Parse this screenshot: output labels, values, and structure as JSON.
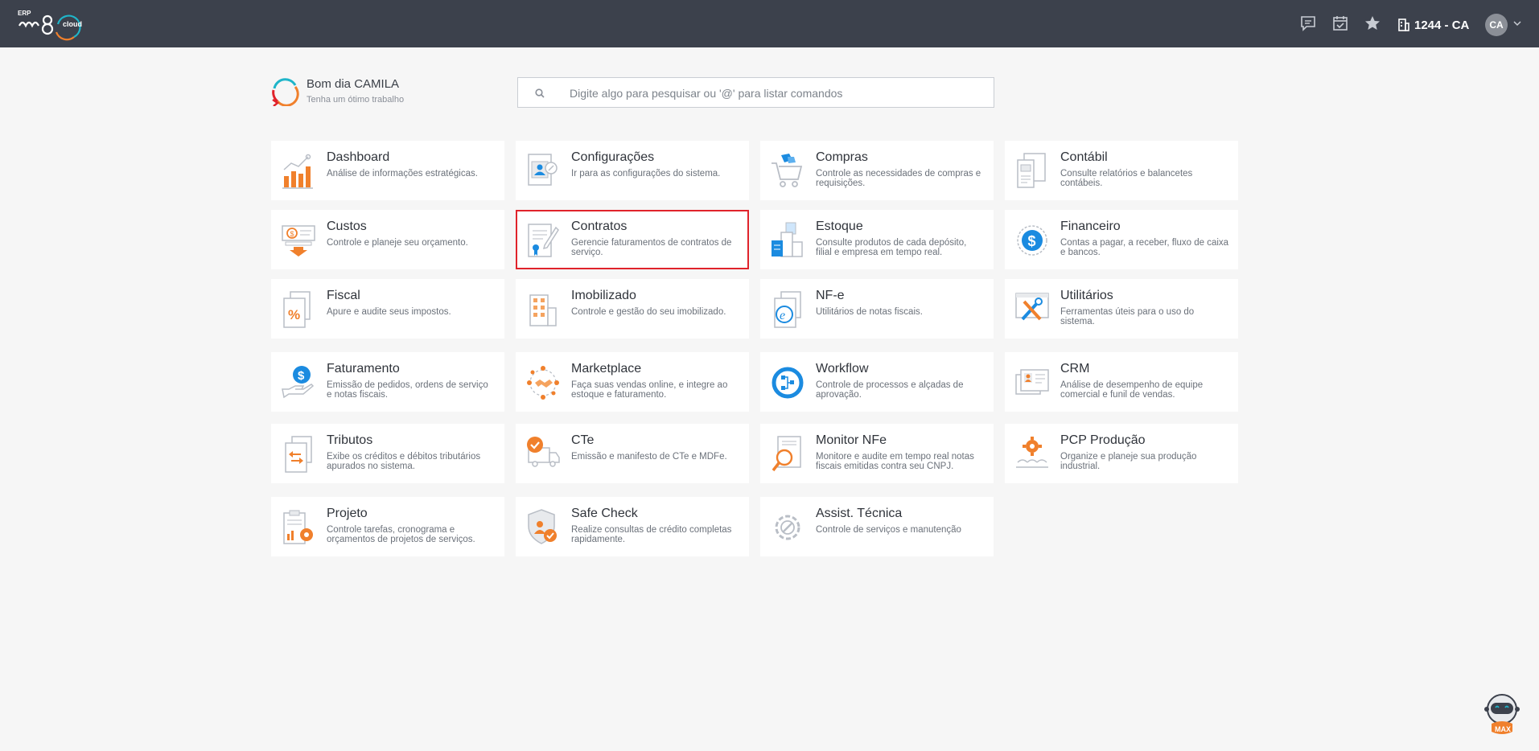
{
  "header": {
    "logo_erp": "ERP",
    "logo_cloud": "cloud",
    "company": "1244 - CA",
    "avatar_initials": "CA"
  },
  "greeting": {
    "title": "Bom dia CAMILA",
    "subtitle": "Tenha um ótimo trabalho"
  },
  "search": {
    "placeholder": "Digite algo para pesquisar ou '@' para listar comandos"
  },
  "modules": [
    {
      "title": "Dashboard",
      "desc": "Análise de informações estratégicas.",
      "icon": "bar-chart-icon"
    },
    {
      "title": "Configurações",
      "desc": "Ir para as configurações do sistema.",
      "icon": "settings-profile-icon"
    },
    {
      "title": "Compras",
      "desc": "Controle as necessidades de compras e requisições.",
      "icon": "shopping-cart-icon"
    },
    {
      "title": "Contábil",
      "desc": "Consulte relatórios e balancetes contábeis.",
      "icon": "accounting-report-icon"
    },
    {
      "title": "Custos",
      "desc": "Controle e planeje seu orçamento.",
      "icon": "costs-icon"
    },
    {
      "title": "Contratos",
      "desc": "Gerencie faturamentos de contratos de serviço.",
      "icon": "contract-icon",
      "selected": true
    },
    {
      "title": "Estoque",
      "desc": "Consulte produtos de cada depósito, filial e empresa em tempo real.",
      "icon": "inventory-icon"
    },
    {
      "title": "Financeiro",
      "desc": "Contas a pagar, a receber, fluxo de caixa e bancos.",
      "icon": "dollar-coin-icon"
    },
    {
      "title": "Fiscal",
      "desc": "Apure e audite seus impostos.",
      "icon": "tax-percent-icon"
    },
    {
      "title": "Imobilizado",
      "desc": "Controle e gestão do seu imobilizado.",
      "icon": "building-icon"
    },
    {
      "title": "NF-e",
      "desc": "Utilitários de notas fiscais.",
      "icon": "nfe-document-icon"
    },
    {
      "title": "Utilitários",
      "desc": "Ferramentas úteis para o uso do sistema.",
      "icon": "tools-icon"
    },
    {
      "title": "Faturamento",
      "desc": "Emissão de pedidos, ordens de serviço e notas fiscais.",
      "icon": "billing-hand-icon"
    },
    {
      "title": "Marketplace",
      "desc": "Faça suas vendas online, e integre ao estoque e faturamento.",
      "icon": "marketplace-handshake-icon"
    },
    {
      "title": "Workflow",
      "desc": "Controle de processos e alçadas de aprovação.",
      "icon": "workflow-icon"
    },
    {
      "title": "CRM",
      "desc": "Análise de desempenho de equipe comercial e funil de vendas.",
      "icon": "crm-cards-icon"
    },
    {
      "title": "Tributos",
      "desc": "Exibe os créditos e débitos tributários apurados no sistema.",
      "icon": "tributes-exchange-icon"
    },
    {
      "title": "CTe",
      "desc": "Emissão e manifesto de CTe e MDFe.",
      "icon": "truck-check-icon"
    },
    {
      "title": "Monitor NFe",
      "desc": "Monitore e audite em tempo real notas fiscais emitidas contra seu CNPJ.",
      "icon": "magnifier-document-icon"
    },
    {
      "title": "PCP Produção",
      "desc": "Organize e planeje sua produção industrial.",
      "icon": "production-gear-icon"
    },
    {
      "title": "Projeto",
      "desc": "Controle tarefas, cronograma e orçamentos de projetos de serviços.",
      "icon": "project-clipboard-icon"
    },
    {
      "title": "Safe Check",
      "desc": "Realize consultas de crédito completas rapidamente.",
      "icon": "shield-check-icon"
    },
    {
      "title": "Assist. Técnica",
      "desc": "Controle de serviços e manutenção",
      "icon": "service-gear-icon"
    }
  ],
  "assistant": {
    "label": "MAX"
  },
  "colors": {
    "topbar": "#3c414c",
    "accent_orange": "#f0802c",
    "accent_blue": "#1b8be0",
    "selected_border": "#e0232b"
  }
}
